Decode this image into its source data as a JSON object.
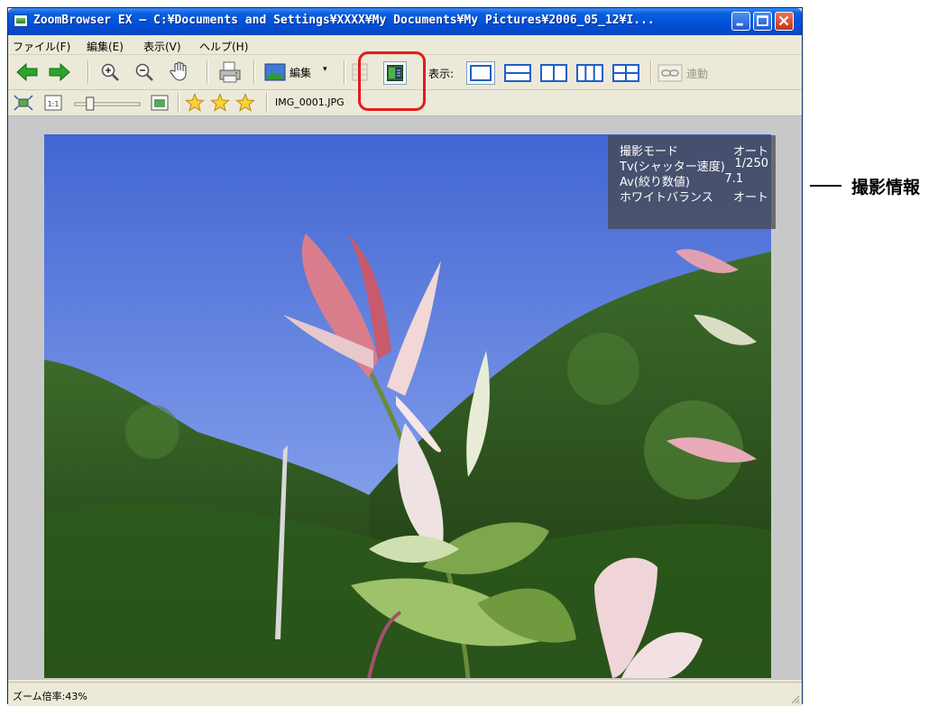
{
  "window": {
    "title": "ZoomBrowser EX – C:¥Documents and Settings¥XXXX¥My Documents¥My Pictures¥2006_05_12¥I..."
  },
  "menu": [
    "ファイル(F)",
    "編集(E)",
    "表示(V)",
    "ヘルプ(H)"
  ],
  "toolbar": {
    "edit_label": "編集",
    "view_label": "表示:",
    "link_label": "連動"
  },
  "toolbar2": {
    "filename": "IMG_0001.JPG",
    "zoom_slider_value": 0.2,
    "rating_stars": 3
  },
  "info_panel": {
    "rows": [
      {
        "label": "撮影モード",
        "value": "オート"
      },
      {
        "label": "Tv(シャッター速度)",
        "value": "1/250"
      },
      {
        "label": "Av(絞り数値)",
        "value": "7.1"
      },
      {
        "label": "ホワイトバランス",
        "value": "オート"
      }
    ]
  },
  "status": {
    "text": "ズーム倍率:43%"
  },
  "callout": {
    "label": "撮影情報"
  },
  "colors": {
    "highlight": "#e31b1b",
    "titlebar": "#0a5fe0"
  }
}
